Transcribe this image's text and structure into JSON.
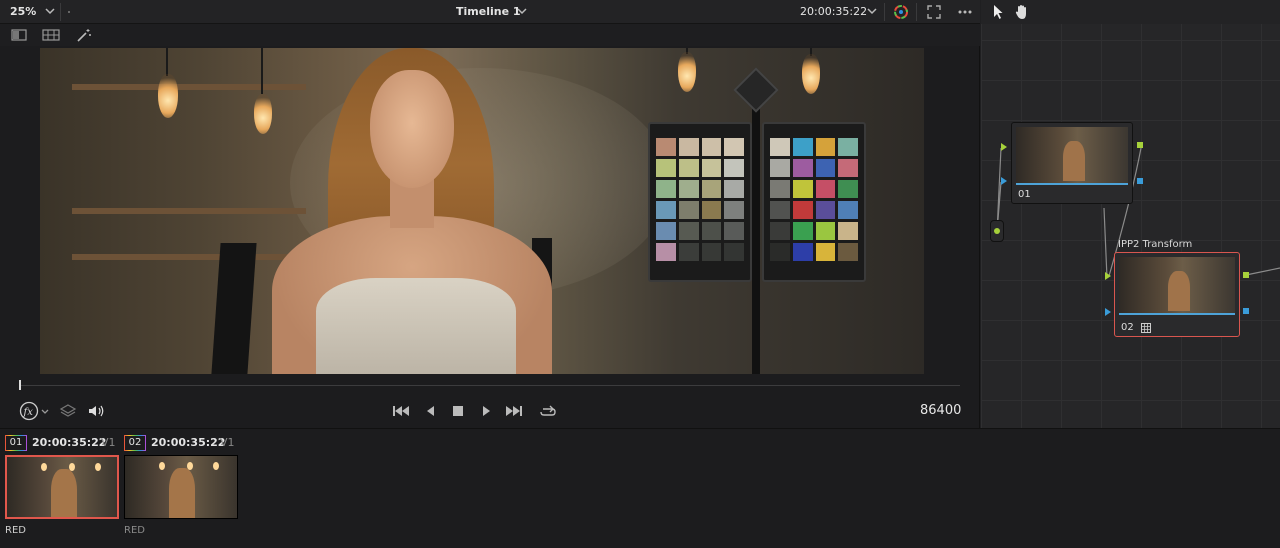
{
  "viewer": {
    "zoom": "25%",
    "timeline_name": "Timeline 1",
    "timecode": "20:00:35:22",
    "frame_counter": "86400"
  },
  "node_editor": {
    "nodes": [
      {
        "number": "01",
        "label": ""
      },
      {
        "number": "02",
        "label": "IPP2 Transform"
      }
    ]
  },
  "clips": [
    {
      "number": "01",
      "timecode": "20:00:35:22",
      "track": "V1",
      "codec": "RED",
      "selected": true
    },
    {
      "number": "02",
      "timecode": "20:00:35:22",
      "track": "V1",
      "codec": "RED",
      "selected": false
    }
  ],
  "icons": {
    "zoom_dropdown": "chevron-down-icon",
    "timeline_dropdown": "chevron-down-icon",
    "color_wheel": "color-wheel-icon",
    "fullscreen": "expand-icon",
    "more": "ellipsis-icon",
    "pointer": "pointer-icon",
    "hand": "hand-icon",
    "split_view": "split-view-icon",
    "grid_view": "grid-view-icon",
    "magic_wand": "magic-wand-icon",
    "fx": "fx-icon",
    "layers": "layers-icon",
    "volume": "volume-icon",
    "skip_back": "skip-back-icon",
    "step_back": "step-back-icon",
    "stop": "stop-icon",
    "play": "play-icon",
    "skip_forward": "skip-forward-icon",
    "loop": "loop-icon"
  },
  "colors": {
    "selection": "#d9564f",
    "node_rgb_port": "#a6d13b",
    "node_alpha_port": "#3a9cd9"
  }
}
